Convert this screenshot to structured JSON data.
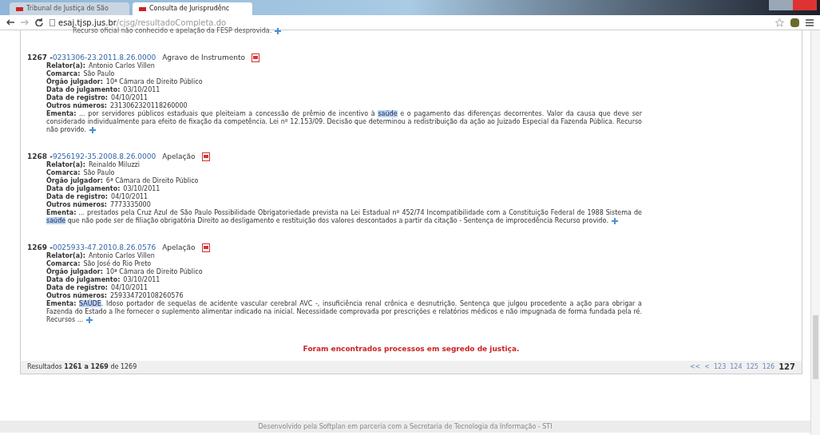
{
  "browser": {
    "tabs": [
      {
        "label": "Tribunal de Justiça de São",
        "selected": false
      },
      {
        "label": "Consulta de Jurisprudênc",
        "selected": true
      }
    ],
    "address": {
      "host": "esaj.tjsp.jus.br",
      "path": "/cjsg/resultadoCompleta.do"
    }
  },
  "previous_text": "Recurso oficial não conhecido e apelação da FESP desprovida.",
  "results": [
    {
      "number": "1267 -",
      "process": "0231306-23.2011.8.26.0000",
      "class": "Agravo de Instrumento",
      "fields": [
        {
          "label": "Relator(a):",
          "value": "Antonio Carlos Villen"
        },
        {
          "label": "Comarca:",
          "value": "São Paulo"
        },
        {
          "label": "Órgão julgador:",
          "value": "10ª Câmara de Direito Público"
        },
        {
          "label": "Data do julgamento:",
          "value": "03/10/2011"
        },
        {
          "label": "Data de registro:",
          "value": "04/10/2011"
        },
        {
          "label": "Outros números:",
          "value": "2313062320118260000"
        }
      ],
      "ementa_label": "Ementa:",
      "ementa": [
        {
          "text": " ... por servidores públicos estaduais que pleiteiam a concessão de prêmio de incentivo à ",
          "highlight": false
        },
        {
          "text": "saúde",
          "highlight": true
        },
        {
          "text": " e o pagamento das diferenças decorrentes. Valor da causa que deve ser considerado individualmente para efeito de fixação da competência. Lei nº 12.153/09. Decisão que determinou a redistribuição da ação ao Juizado Especial da Fazenda Pública. Recurso não provido.",
          "highlight": false
        }
      ]
    },
    {
      "number": "1268 -",
      "process": "9256192-35.2008.8.26.0000",
      "class": "Apelação",
      "fields": [
        {
          "label": "Relator(a):",
          "value": "Reinaldo Miluzzi"
        },
        {
          "label": "Comarca:",
          "value": "São Paulo"
        },
        {
          "label": "Órgão julgador:",
          "value": "6ª Câmara de Direito Público"
        },
        {
          "label": "Data do julgamento:",
          "value": "03/10/2011"
        },
        {
          "label": "Data de registro:",
          "value": "04/10/2011"
        },
        {
          "label": "Outros números:",
          "value": "7773335000"
        }
      ],
      "ementa_label": "Ementa:",
      "ementa": [
        {
          "text": " ... prestados pela Cruz Azul de São Paulo Possibilidade Obrigatoriedade prevista na Lei Estadual nº 452/74 Incompatibilidade com a Constituição Federal de 1988 Sistema de ",
          "highlight": false
        },
        {
          "text": "saúde",
          "highlight": true
        },
        {
          "text": " que não pode ser de filiação obrigatória Direito ao desligamento e restituição dos valores descontados a partir da citação - Sentença de improcedência Recurso provido.",
          "highlight": false
        }
      ]
    },
    {
      "number": "1269 -",
      "process": "0025933-47.2010.8.26.0576",
      "class": "Apelação",
      "fields": [
        {
          "label": "Relator(a):",
          "value": "Antonio Carlos Villen"
        },
        {
          "label": "Comarca:",
          "value": "São José do Rio Preto"
        },
        {
          "label": "Órgão julgador:",
          "value": "10ª Câmara de Direito Público"
        },
        {
          "label": "Data do julgamento:",
          "value": "03/10/2011"
        },
        {
          "label": "Data de registro:",
          "value": "04/10/2011"
        },
        {
          "label": "Outros números:",
          "value": "259334720108260576"
        }
      ],
      "ementa_label": "Ementa:",
      "ementa": [
        {
          "text": "SAÚDE",
          "highlight": true
        },
        {
          "text": ". Idoso portador de sequelas de acidente vascular cerebral AVC -, insuficiência renal crônica e desnutrição. Sentença que julgou procedente a ação para obrigar a Fazenda do Estado a lhe fornecer o suplemento alimentar indicado na inicial. Necessidade comprovada por prescrições e relatórios médicos e não impugnada de forma fundada pela ré. Recursos ...",
          "highlight": false
        }
      ]
    }
  ],
  "secret_notice": "Foram encontrados processos em segredo de justiça.",
  "summary": {
    "prefix": "Resultados",
    "from": "1261",
    "middle": "a",
    "to": "1269",
    "of": "de",
    "total": "1269"
  },
  "pagination": [
    {
      "label": "<<",
      "selected": false
    },
    {
      "label": "<",
      "selected": false
    },
    {
      "label": "123",
      "selected": false
    },
    {
      "label": "124",
      "selected": false
    },
    {
      "label": "125",
      "selected": false
    },
    {
      "label": "126",
      "selected": false
    },
    {
      "label": "127",
      "selected": true
    }
  ],
  "footer": "Desenvolvido pela Softplan em parceria com a Secretaria de Tecnologia da Informação - STI"
}
